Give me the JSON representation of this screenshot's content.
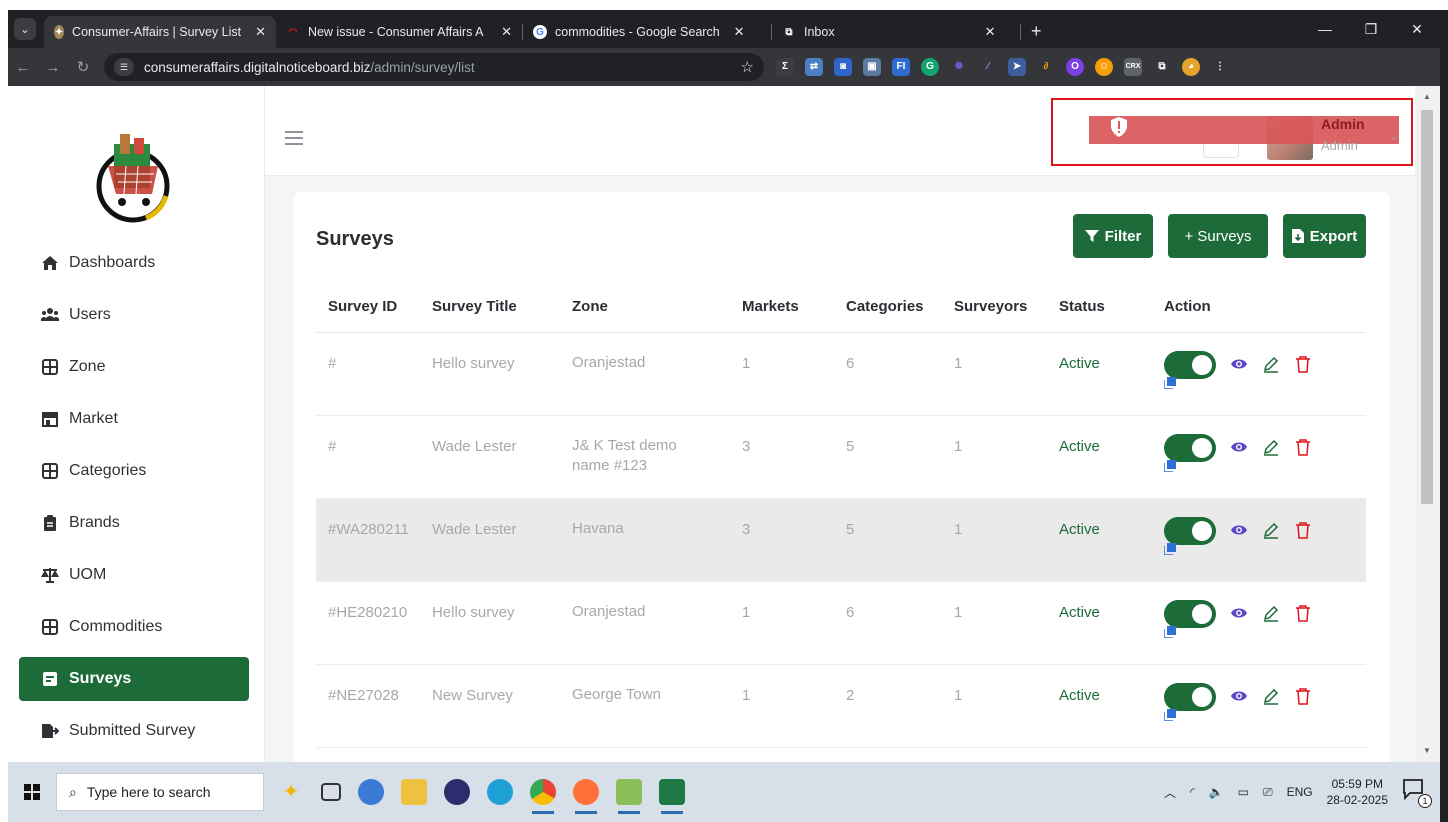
{
  "browser": {
    "tabs": [
      {
        "title": "Consumer-Affairs | Survey List",
        "active": true,
        "favicon": "site-favicon"
      },
      {
        "title": "New issue - Consumer Affairs A",
        "active": false,
        "favicon": "gitlab-icon"
      },
      {
        "title": "commodities - Google Search",
        "active": false,
        "favicon": "google-icon"
      },
      {
        "title": "Inbox",
        "active": false,
        "favicon": "inbox-icon"
      }
    ],
    "url_host": "consumeraffairs.digitalnoticeboard.biz",
    "url_path": "/admin/survey/list"
  },
  "sidebar": {
    "items": [
      {
        "label": "Dashboards",
        "icon": "home-icon",
        "active": false
      },
      {
        "label": "Users",
        "icon": "users-icon",
        "active": false
      },
      {
        "label": "Zone",
        "icon": "grid-icon",
        "active": false
      },
      {
        "label": "Market",
        "icon": "store-icon",
        "active": false
      },
      {
        "label": "Categories",
        "icon": "grid-icon",
        "active": false
      },
      {
        "label": "Brands",
        "icon": "clipboard-icon",
        "active": false
      },
      {
        "label": "UOM",
        "icon": "scale-icon",
        "active": false
      },
      {
        "label": "Commodities",
        "icon": "grid-icon",
        "active": false
      },
      {
        "label": "Surveys",
        "icon": "survey-icon",
        "active": true
      },
      {
        "label": "Submitted Survey",
        "icon": "file-export-icon",
        "active": false
      }
    ]
  },
  "header": {
    "user_name": "Admin",
    "user_role": "Admin"
  },
  "page": {
    "title": "Surveys",
    "buttons": {
      "filter": "Filter",
      "add": "+ Surveys",
      "export": "Export"
    },
    "columns": [
      "Survey ID",
      "Survey Title",
      "Zone",
      "Markets",
      "Categories",
      "Surveyors",
      "Status",
      "Action"
    ],
    "rows": [
      {
        "id": "#",
        "title": "Hello survey",
        "zone": "Oranjestad",
        "markets": "1",
        "categories": "6",
        "surveyors": "1",
        "status": "Active",
        "enabled": true
      },
      {
        "id": "#",
        "title": "Wade Lester",
        "zone": "J& K Test demo name #123",
        "markets": "3",
        "categories": "5",
        "surveyors": "1",
        "status": "Active",
        "enabled": true
      },
      {
        "id": "#WA280211",
        "title": "Wade Lester",
        "zone": "Havana",
        "markets": "3",
        "categories": "5",
        "surveyors": "1",
        "status": "Active",
        "enabled": true,
        "highlighted": true
      },
      {
        "id": "#HE280210",
        "title": "Hello survey",
        "zone": "Oranjestad",
        "markets": "1",
        "categories": "6",
        "surveyors": "1",
        "status": "Active",
        "enabled": true
      },
      {
        "id": "#NE27028",
        "title": "New Survey",
        "zone": "George Town",
        "markets": "1",
        "categories": "2",
        "surveyors": "1",
        "status": "Active",
        "enabled": true
      }
    ]
  },
  "taskbar": {
    "search_placeholder": "Type here to search",
    "language": "ENG",
    "time": "05:59 PM",
    "date": "28-02-2025",
    "notification_count": "1"
  },
  "colors": {
    "primary": "#1c6b39",
    "danger": "#e0131a",
    "view": "#5b47c9"
  }
}
